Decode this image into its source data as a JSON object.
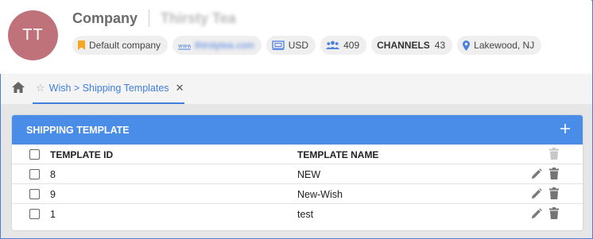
{
  "header": {
    "avatar_initials": "TT",
    "company_label": "Company",
    "company_name": "Thirsty Tea",
    "chips": {
      "default_company": "Default company",
      "website": "thirstytea.com",
      "currency": "USD",
      "users_count": "409",
      "channels_label": "CHANNELS",
      "channels_count": "43",
      "location": "Lakewood, NJ"
    }
  },
  "tabs": {
    "active_tab_label": "Wish > Shipping Templates"
  },
  "panel": {
    "title": "SHIPPING TEMPLATE",
    "columns": {
      "id": "TEMPLATE ID",
      "name": "TEMPLATE NAME"
    },
    "rows": [
      {
        "id": "8",
        "name": "NEW"
      },
      {
        "id": "9",
        "name": "New-Wish"
      },
      {
        "id": "1",
        "name": "test"
      }
    ]
  },
  "icons": {
    "home": "home-icon",
    "star": "star-icon",
    "close": "close-icon",
    "add": "plus-icon",
    "edit": "pencil-icon",
    "delete": "trash-icon",
    "bookmark": "bookmark-icon",
    "globe": "globe-icon",
    "currency": "money-icon",
    "users": "users-icon",
    "location": "map-pin-icon"
  },
  "colors": {
    "accent": "#4a8de8",
    "avatar": "#c0727a",
    "link": "#3e7fe0",
    "bookmark": "#f5a623"
  }
}
